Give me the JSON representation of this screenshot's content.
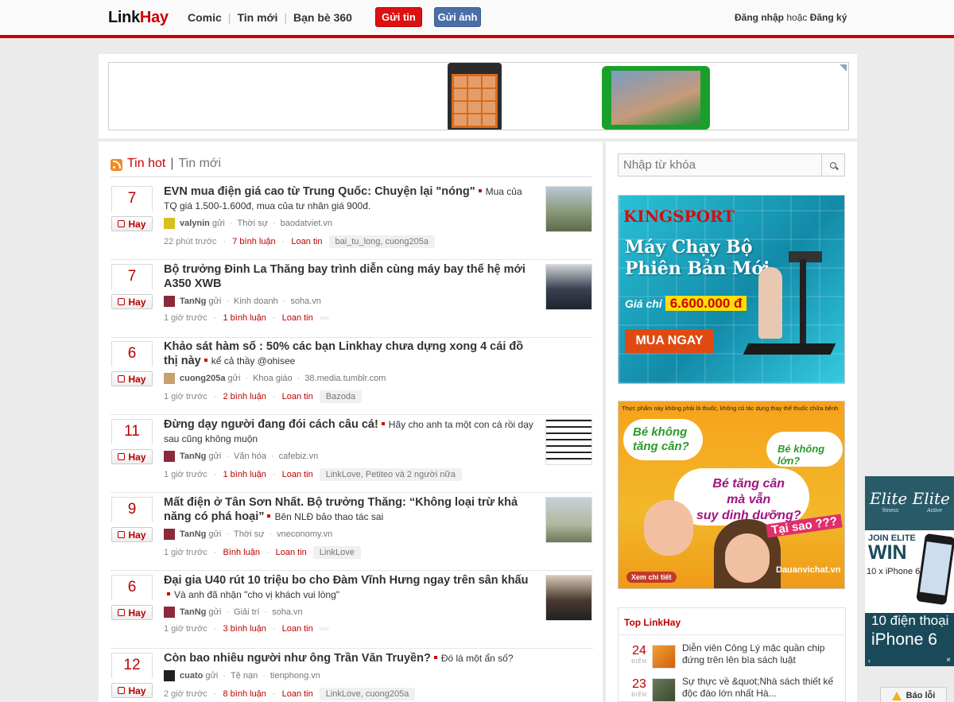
{
  "header": {
    "logo_link": "Link",
    "logo_hay": "Hay",
    "nav": [
      "Comic",
      "Tin mới",
      "Bạn bè 360"
    ],
    "btn_gui_tin": "Gửi tin",
    "btn_gui_anh": "Gửi ảnh",
    "login": "Đăng nhập",
    "or": "hoặc",
    "register": "Đăng ký"
  },
  "tabs": {
    "hot": "Tin hot",
    "sep": "|",
    "new": "Tin mới"
  },
  "vote_label": "Hay",
  "items": [
    {
      "count": "7",
      "title": "EVN mua điện giá cao từ Trung Quốc: Chuyện lại \"nóng\"",
      "summary": "Mua của TQ giá 1.500-1.600đ, mua của tư nhân giá 900đ.",
      "user": "valynin",
      "sent": "gửi",
      "category": "Thời sự",
      "source": "baodatviet.vn",
      "time": "22 phút trước",
      "comments": "7 bình luận",
      "spread": "Loan tin",
      "tags": "bai_tu_long, cuong205a"
    },
    {
      "count": "7",
      "title": "Bộ trưởng Đinh La Thăng bay trình diễn cùng máy bay thế hệ mới A350 XWB",
      "summary": "",
      "user": "TanNg",
      "sent": "gửi",
      "category": "Kinh doanh",
      "source": "soha.vn",
      "time": "1 giờ trước",
      "comments": "1 bình luận",
      "spread": "Loan tin",
      "tags": ""
    },
    {
      "count": "6",
      "title": "Khảo sát hàm số : 50% các bạn Linkhay chưa dựng xong 4 cái đồ thị này",
      "summary": "kể cả thầy @ohisee",
      "user": "cuong205a",
      "sent": "gửi",
      "category": "Khoa giáo",
      "source": "38.media.tumblr.com",
      "time": "1 giờ trước",
      "comments": "2 bình luận",
      "spread": "Loan tin",
      "tags": "Bazoda"
    },
    {
      "count": "11",
      "title": "Đừng dạy người đang đói cách câu cá!",
      "summary": "Hãy cho anh ta một con cá rồi dạy sau cũng không muộn",
      "user": "TanNg",
      "sent": "gửi",
      "category": "Văn hóa",
      "source": "cafebiz.vn",
      "time": "1 giờ trước",
      "comments": "1 bình luận",
      "spread": "Loan tin",
      "tags": "LinkLove, Petiteo và 2 người nữa"
    },
    {
      "count": "9",
      "title": "Mất điện ở Tân Sơn Nhất. Bộ trưởng Thăng: “Không loại trừ khả năng có phá hoại”",
      "summary": "Bên NLĐ bảo thao tác sai",
      "user": "TanNg",
      "sent": "gửi",
      "category": "Thời sự",
      "source": "vneconomy.vn",
      "time": "1 giờ trước",
      "comments": "Bình luận",
      "spread": "Loan tin",
      "tags": "LinkLove"
    },
    {
      "count": "6",
      "title": "Đại gia U40 rút 10 triệu bo cho Đàm Vĩnh Hưng ngay trên sân khấu",
      "summary": "Và anh đã nhận \"cho vị khách vui lòng\"",
      "user": "TanNg",
      "sent": "gửi",
      "category": "Giải trí",
      "source": "soha.vn",
      "time": "1 giờ trước",
      "comments": "3 bình luận",
      "spread": "Loan tin",
      "tags": ""
    },
    {
      "count": "12",
      "title": "Còn bao nhiêu người như ông Trần Văn Truyền?",
      "summary": "Đó là một ẩn số?",
      "user": "cuato",
      "sent": "gửi",
      "category": "Tệ nạn",
      "source": "tienphong.vn",
      "time": "2 giờ trước",
      "comments": "8 bình luận",
      "spread": "Loan tin",
      "tags": "LinkLove, cuong205a"
    }
  ],
  "search": {
    "placeholder": "Nhập từ khóa"
  },
  "ad_kingsport": {
    "brand": "KINGSPORT",
    "line1": "Máy Chạy Bộ",
    "line2": "Phiên Bản Mới",
    "price_label": "Giá chỉ",
    "price": "6.600.000 đ",
    "cta": "MUA NGAY"
  },
  "ad_daua": {
    "note": "Thực phẩm này không phải là thuốc, không có tác dụng thay thế thuốc chữa bệnh",
    "q1a": "Bé không",
    "q1b": "tăng cân?",
    "q2": "Bé không lớn?",
    "q3a": "Bé tăng cân",
    "q3b": "mà vẫn",
    "q3c": "suy dinh dưỡng?",
    "q4": "Tại sao ???",
    "more": "Xem chi tiết",
    "site": "Dauanvichat.vn"
  },
  "top": {
    "title": "Top LinkHay",
    "score_label": "ĐIỂM",
    "items": [
      {
        "score": "24",
        "title": "Diễn viên Công Lý mặc quần chip đứng trên lên bìa sách luật"
      },
      {
        "score": "23",
        "title": "Sự thực về &quot;Nhà sách thiết kế độc đáo lớn nhất Hà..."
      }
    ]
  },
  "elite": {
    "logo": "Elite Elite",
    "sub1": "fitness",
    "sub2": "Active",
    "join": "JOIN ELITE",
    "win": "WIN",
    "prize": "10 x iPhone 6",
    "ten": "10 điện thoại",
    "iphone": "iPhone 6",
    "prev": "‹",
    "close": "×"
  },
  "bao_loi": "Báo lỗi",
  "colors": {
    "accent": "#cc0000",
    "facebook": "#4a6ea8"
  }
}
